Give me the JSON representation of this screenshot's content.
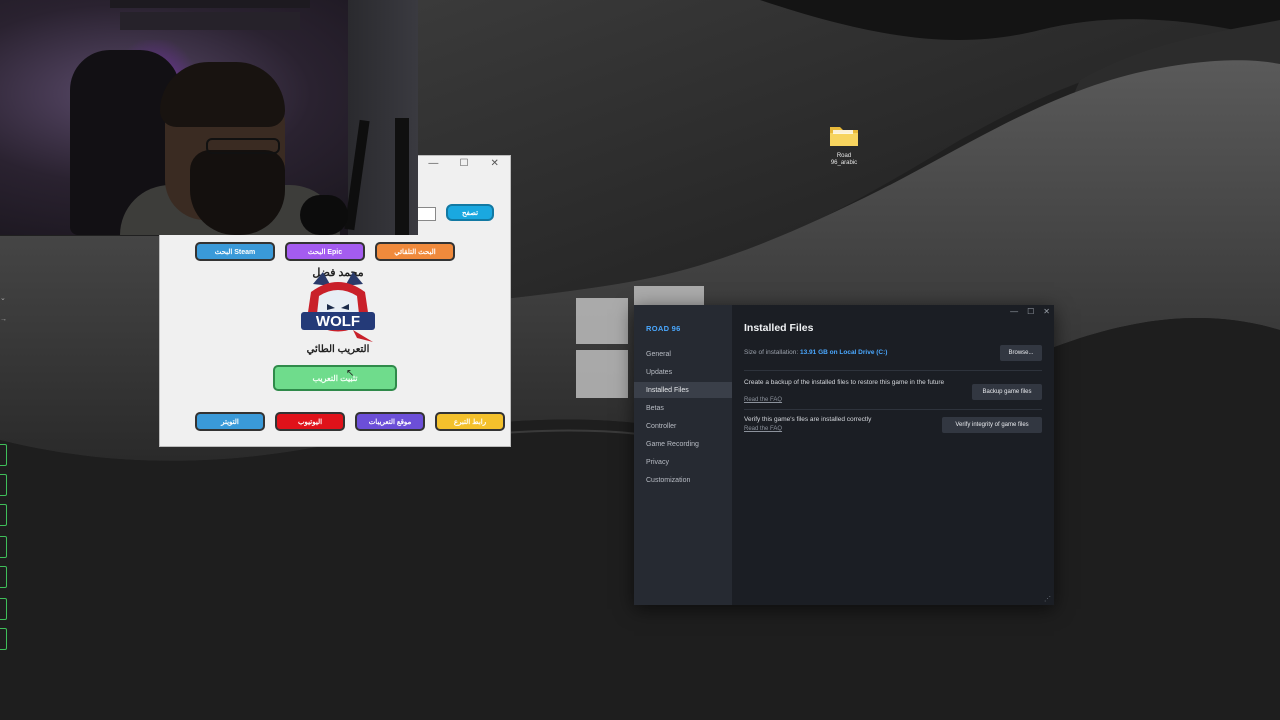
{
  "desktop": {
    "folder_name": "Road 96_arabic"
  },
  "tool_window": {
    "browse_label": "تصفح",
    "steam_search_label": "البحث Steam",
    "epic_search_label": "البحث Epic",
    "auto_search_label": "البحث التلقائي",
    "logo_top_text": "محمد فضل",
    "logo_word": "WOLF",
    "logo_bottom_text": "التعريب الطائي",
    "install_label": "تثبيت التعريب",
    "twitter_label": "التويتر",
    "youtube_label": "اليوتيوب",
    "site_label": "موقع التعريبات",
    "donate_label": "رابط التبرع",
    "colors": {
      "steam": "#3a9ad9",
      "epic": "#a45cf0",
      "auto": "#f08a3c",
      "install": "#6fdc8c",
      "twitter": "#3a9ad9",
      "youtube": "#e0121a",
      "site": "#6c4fd8",
      "donate": "#f4c12c",
      "browse": "#1aa8e0"
    }
  },
  "steam": {
    "game_title": "ROAD 96",
    "nav": [
      "General",
      "Updates",
      "Installed Files",
      "Betas",
      "Controller",
      "Game Recording",
      "Privacy",
      "Customization"
    ],
    "active_nav": "Installed Files",
    "heading": "Installed Files",
    "size_label": "Size of installation:",
    "size_value": "13.91 GB on Local Drive (C:)",
    "browse_button": "Browse...",
    "backup_text": "Create a backup of the installed files to restore this game in the future",
    "backup_link": "Read the FAQ",
    "backup_button": "Backup game files",
    "verify_text": "Verify this game's files are installed correctly",
    "verify_link": "Read the FAQ",
    "verify_button": "Verify integrity of game files",
    "accent": "#4aa8ff"
  }
}
